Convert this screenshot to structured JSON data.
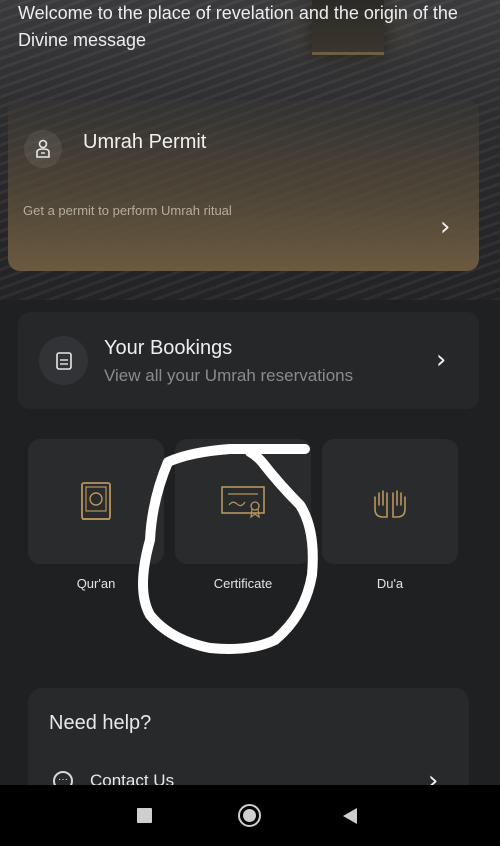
{
  "header": {
    "welcome_text": "Welcome to the place of revelation and the origin of the Divine message"
  },
  "permit_card": {
    "title": "Umrah Permit",
    "subtitle": "Get a permit to perform Umrah ritual",
    "icon": "person-icon",
    "chevron": "›"
  },
  "bookings_card": {
    "title": "Your Bookings",
    "subtitle": "View all your Umrah reservations",
    "icon": "document-icon",
    "chevron": "›"
  },
  "quick_links": [
    {
      "label": "Qur'an",
      "icon": "quran-book-icon"
    },
    {
      "label": "Certificate",
      "icon": "certificate-icon"
    },
    {
      "label": "Du'a",
      "icon": "praying-hands-icon"
    }
  ],
  "help": {
    "title": "Need help?",
    "contact_label": "Contact Us",
    "chevron": "›"
  },
  "colors": {
    "accent_gold": "#b8955e",
    "background": "#1f2022",
    "card": "#2a2b2d",
    "annotation": "#ffffff"
  },
  "system_nav": [
    "recents-button",
    "home-button",
    "back-button"
  ]
}
